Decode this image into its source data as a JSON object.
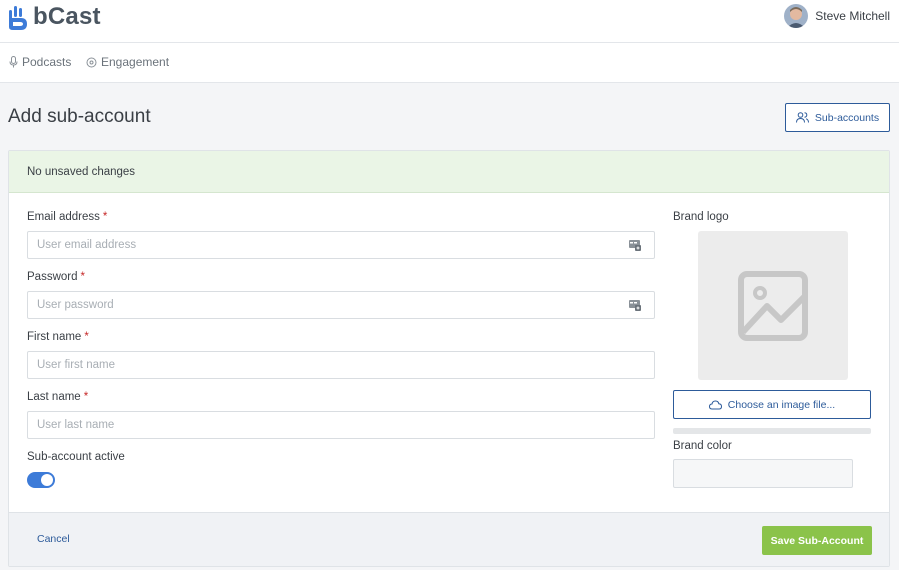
{
  "app": {
    "brand": "bCast"
  },
  "user": {
    "name": "Steve Mitchell"
  },
  "nav": {
    "items": [
      {
        "label": "Podcasts",
        "icon": "microphone-icon"
      },
      {
        "label": "Engagement",
        "icon": "engagement-icon"
      }
    ]
  },
  "page": {
    "title": "Add sub-account",
    "subaccounts_button": "Sub-accounts"
  },
  "status": {
    "text": "No unsaved changes"
  },
  "form": {
    "email": {
      "label": "Email address",
      "required": "*",
      "placeholder": "User email address",
      "value": ""
    },
    "password": {
      "label": "Password",
      "required": "*",
      "placeholder": "User password",
      "value": ""
    },
    "first_name": {
      "label": "First name",
      "required": "*",
      "placeholder": "User first name",
      "value": ""
    },
    "last_name": {
      "label": "Last name",
      "required": "*",
      "placeholder": "User last name",
      "value": ""
    },
    "active": {
      "label": "Sub-account active",
      "checked": true
    }
  },
  "brand": {
    "logo_label": "Brand logo",
    "choose_button": "Choose an image file...",
    "upload_progress": 0,
    "color_label": "Brand color",
    "color_value": ""
  },
  "footer": {
    "cancel": "Cancel",
    "save": "Save Sub-Account"
  },
  "colors": {
    "accent": "#2d5b9a",
    "toggle": "#3d7bd8",
    "save": "#8bc34a",
    "status_bg": "#eaf5e6",
    "required": "#c62828"
  }
}
